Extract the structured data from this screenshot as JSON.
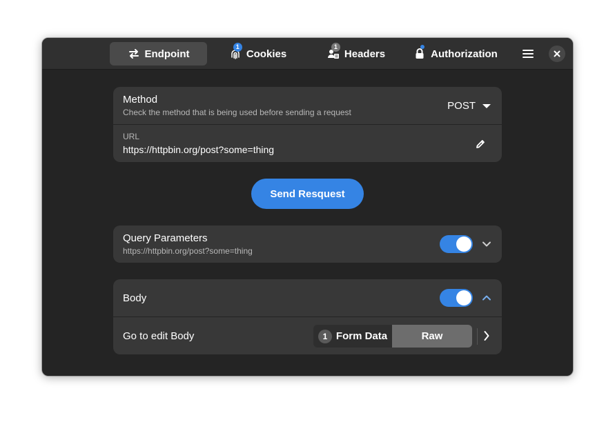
{
  "header": {
    "tabs": [
      {
        "label": "Endpoint",
        "icon": "arrows-swap-icon",
        "active": true
      },
      {
        "label": "Cookies",
        "icon": "fingerprint-icon",
        "badge": "1"
      },
      {
        "label": "Headers",
        "icon": "user-list-icon",
        "badge": "1"
      },
      {
        "label": "Authorization",
        "icon": "lock-icon",
        "indicator": "blue-dot"
      }
    ],
    "menu_icon": "hamburger-menu-icon",
    "close_icon": "close-icon"
  },
  "endpoint": {
    "method": {
      "title": "Method",
      "subtitle": "Check the method that is being used before sending a request",
      "value": "POST"
    },
    "url": {
      "caption": "URL",
      "value": "https://httpbin.org/post?some=thing"
    }
  },
  "send_button": "Send Resquest",
  "query": {
    "title": "Query Parameters",
    "subtitle": "https://httpbin.org/post?some=thing",
    "enabled": true
  },
  "body": {
    "title": "Body",
    "enabled": true,
    "edit_label": "Go to edit Body",
    "form_data_count": "1",
    "form_data_label": "Form Data",
    "raw_label": "Raw"
  },
  "colors": {
    "accent": "#3584e4",
    "window_bg": "#242424",
    "card_bg": "#383838",
    "headerbar_bg": "#303030"
  }
}
